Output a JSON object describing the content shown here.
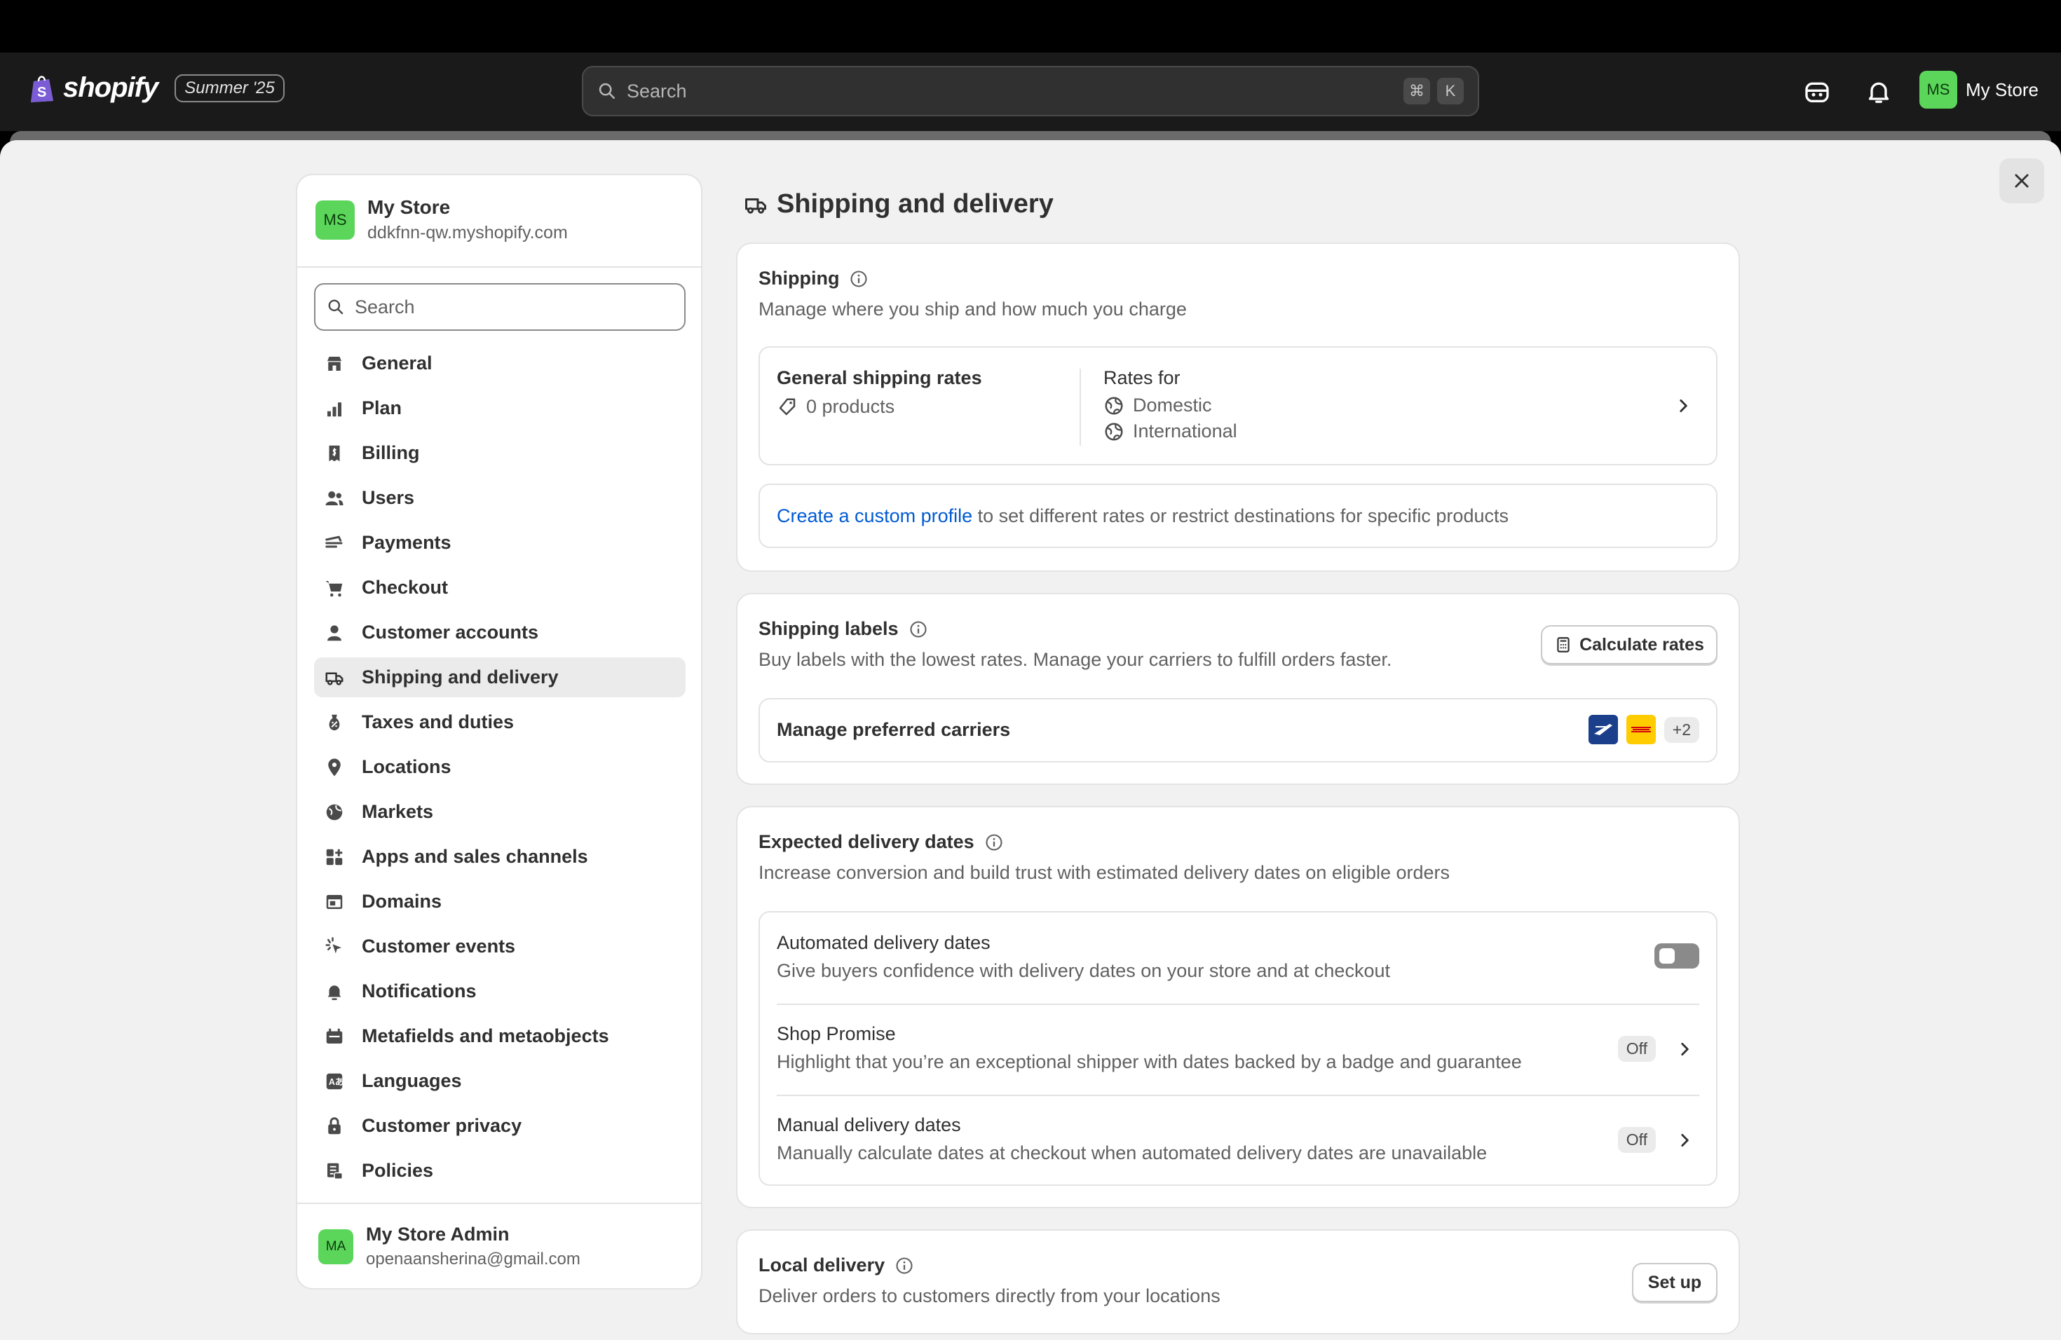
{
  "topbar": {
    "brand": "shopify",
    "edition": "Summer '25",
    "search_placeholder": "Search",
    "shortcut_keys": [
      "⌘",
      "K"
    ],
    "store_initials": "MS",
    "store_name": "My Store",
    "icons": [
      "shopify-bag-icon",
      "search-icon",
      "sidekick-icon",
      "bell-icon"
    ]
  },
  "sidebar": {
    "store_initials": "MS",
    "store_name": "My Store",
    "store_domain": "ddkfnn-qw.myshopify.com",
    "search_placeholder": "Search",
    "items": [
      {
        "label": "General",
        "icon": "store-icon"
      },
      {
        "label": "Plan",
        "icon": "chart-icon"
      },
      {
        "label": "Billing",
        "icon": "receipt-icon"
      },
      {
        "label": "Users",
        "icon": "users-icon"
      },
      {
        "label": "Payments",
        "icon": "payment-icon"
      },
      {
        "label": "Checkout",
        "icon": "cart-icon"
      },
      {
        "label": "Customer accounts",
        "icon": "person-icon"
      },
      {
        "label": "Shipping and delivery",
        "icon": "truck-icon",
        "active": true
      },
      {
        "label": "Taxes and duties",
        "icon": "tax-icon"
      },
      {
        "label": "Locations",
        "icon": "location-icon"
      },
      {
        "label": "Markets",
        "icon": "globe-icon"
      },
      {
        "label": "Apps and sales channels",
        "icon": "apps-icon"
      },
      {
        "label": "Domains",
        "icon": "domain-icon"
      },
      {
        "label": "Customer events",
        "icon": "cursor-icon"
      },
      {
        "label": "Notifications",
        "icon": "bell-icon"
      },
      {
        "label": "Metafields and metaobjects",
        "icon": "database-icon"
      },
      {
        "label": "Languages",
        "icon": "language-icon"
      },
      {
        "label": "Customer privacy",
        "icon": "lock-icon"
      },
      {
        "label": "Policies",
        "icon": "policy-icon"
      }
    ],
    "admin_initials": "MA",
    "admin_name": "My Store Admin",
    "admin_email": "openaansherina@gmail.com"
  },
  "main": {
    "title": "Shipping and delivery",
    "shipping": {
      "title": "Shipping",
      "subtitle": "Manage where you ship and how much you charge",
      "rates_title": "General shipping rates",
      "products": "0 products",
      "rates_for": "Rates for",
      "domestic": "Domestic",
      "international": "International",
      "custom_link": "Create a custom profile",
      "custom_rest": " to set different rates or restrict destinations for specific products"
    },
    "labels": {
      "title": "Shipping labels",
      "subtitle": "Buy labels with the lowest rates. Manage your carriers to fulfill orders faster.",
      "calc_button": "Calculate rates",
      "carriers": "Manage preferred carriers",
      "more_carriers": "+2"
    },
    "delivery_dates": {
      "title": "Expected delivery dates",
      "subtitle": "Increase conversion and build trust with estimated delivery dates on eligible orders",
      "auto_title": "Automated delivery dates",
      "auto_sub": "Give buyers confidence with delivery dates on your store and at checkout",
      "auto_enabled": false,
      "promise_title": "Shop Promise",
      "promise_sub": "Highlight that you’re an exceptional shipper with dates backed by a badge and guarantee",
      "promise_status": "Off",
      "manual_title": "Manual delivery dates",
      "manual_sub": "Manually calculate dates at checkout when automated delivery dates are unavailable",
      "manual_status": "Off"
    },
    "local": {
      "title": "Local delivery",
      "subtitle": "Deliver orders to customers directly from your locations",
      "setup_button": "Set up"
    }
  }
}
